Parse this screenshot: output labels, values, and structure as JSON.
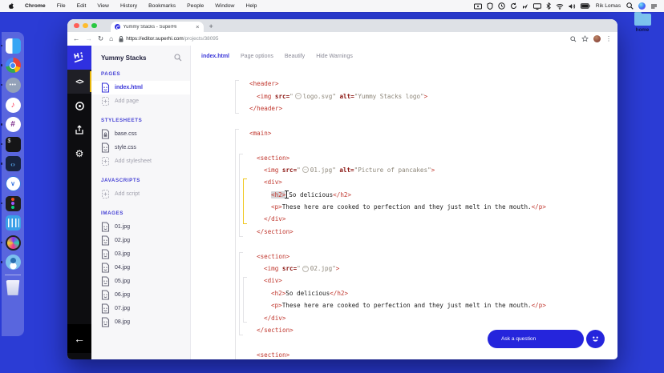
{
  "menu_bar": {
    "items": [
      "Chrome",
      "File",
      "Edit",
      "View",
      "History",
      "Bookmarks",
      "People",
      "Window",
      "Help"
    ],
    "status_icons": [
      "screen-mirror",
      "shield",
      "clock",
      "sync",
      "location",
      "display",
      "bluetooth",
      "wifi",
      "volume",
      "battery"
    ],
    "username": "Rik Lomas",
    "right_icons": [
      "spotlight",
      "siri",
      "notification-center"
    ]
  },
  "desktop": {
    "folder_label": "home"
  },
  "dock": {
    "apps": [
      {
        "name": "finder",
        "kind": "finder",
        "running": true,
        "glyph": ""
      },
      {
        "name": "chrome",
        "kind": "chrome",
        "running": true,
        "glyph": ""
      },
      {
        "name": "messages",
        "kind": "messages",
        "running": true,
        "glyph": "•••"
      },
      {
        "name": "music",
        "kind": "music",
        "running": false,
        "glyph": "♪"
      },
      {
        "name": "slack",
        "kind": "slack",
        "running": true,
        "glyph": "#"
      },
      {
        "name": "terminal",
        "kind": "terminal",
        "running": true,
        "glyph": "$"
      },
      {
        "name": "vscode",
        "kind": "vscode",
        "running": true,
        "glyph": "‹›"
      },
      {
        "name": "mail",
        "kind": "mail",
        "running": false,
        "glyph": "∨"
      },
      {
        "name": "figma",
        "kind": "figma",
        "running": true,
        "glyph": ""
      },
      {
        "name": "intercom",
        "kind": "intercom",
        "running": false,
        "glyph": ""
      },
      {
        "name": "screenflow",
        "kind": "screenflow",
        "running": true,
        "glyph": ""
      },
      {
        "name": "twitterrific",
        "kind": "twitterrific",
        "running": true,
        "glyph": ""
      }
    ],
    "trash": {
      "name": "trash",
      "kind": "trash"
    }
  },
  "browser": {
    "tab_title": "Yummy Stacks - SuperHi",
    "close_tab": "×",
    "new_tab": "+",
    "back": "←",
    "forward": "→",
    "reload": "↻",
    "home": "⌂",
    "url_domain": "https://editor.superhi.com",
    "url_path": "/projects/38095",
    "kebab": "⋮"
  },
  "editor": {
    "project_title": "Yummy Stacks",
    "rail": {
      "code_glyph": "<>",
      "gear_glyph": "⚙",
      "back_glyph": "←"
    },
    "panel_sections": [
      {
        "header": "PAGES",
        "items": [
          {
            "label": "index.html",
            "icon": "doc",
            "active": true
          }
        ],
        "add": "Add page"
      },
      {
        "header": "STYLESHEETS",
        "items": [
          {
            "label": "base.css",
            "icon": "doc-lock",
            "active": false
          },
          {
            "label": "style.css",
            "icon": "doc",
            "active": false
          }
        ],
        "add": "Add stylesheet"
      },
      {
        "header": "JAVASCRIPTS",
        "items": [],
        "add": "Add script"
      },
      {
        "header": "IMAGES",
        "items": [
          {
            "label": "01.jpg",
            "icon": "doc",
            "active": false
          },
          {
            "label": "02.jpg",
            "icon": "doc",
            "active": false
          },
          {
            "label": "03.jpg",
            "icon": "doc",
            "active": false
          },
          {
            "label": "04.jpg",
            "icon": "doc",
            "active": false
          },
          {
            "label": "05.jpg",
            "icon": "doc",
            "active": false
          },
          {
            "label": "06.jpg",
            "icon": "doc",
            "active": false
          },
          {
            "label": "07.jpg",
            "icon": "doc",
            "active": false
          },
          {
            "label": "08.jpg",
            "icon": "doc",
            "active": false
          }
        ],
        "add": null
      }
    ],
    "tabs": [
      {
        "label": "index.html",
        "active": true
      },
      {
        "label": "Page options",
        "active": false
      },
      {
        "label": "Beautify",
        "active": false
      },
      {
        "label": "Hide Warnings",
        "active": false
      }
    ],
    "code": {
      "lines": [
        {
          "i": 0,
          "seg": [
            [
              "tag",
              "<header>"
            ]
          ]
        },
        {
          "i": 1,
          "seg": [
            [
              "tag",
              "<img"
            ],
            [
              "plain",
              " "
            ],
            [
              "attr",
              "src="
            ],
            [
              "q",
              "\""
            ],
            [
              "chip",
              "logo.svg"
            ],
            [
              "q",
              "\""
            ],
            [
              "plain",
              " "
            ],
            [
              "attr",
              "alt="
            ],
            [
              "q",
              "\"Yummy Stacks logo\""
            ],
            [
              "tag",
              ">"
            ]
          ]
        },
        {
          "i": 0,
          "seg": [
            [
              "tag",
              "</header>"
            ]
          ]
        },
        null,
        {
          "i": 0,
          "seg": [
            [
              "tag",
              "<main>"
            ]
          ]
        },
        null,
        {
          "i": 1,
          "seg": [
            [
              "tag",
              "<section>"
            ]
          ]
        },
        {
          "i": 2,
          "seg": [
            [
              "tag",
              "<img"
            ],
            [
              "plain",
              " "
            ],
            [
              "attr",
              "src="
            ],
            [
              "q",
              "\""
            ],
            [
              "chip",
              "01.jpg"
            ],
            [
              "q",
              "\""
            ],
            [
              "plain",
              " "
            ],
            [
              "attr",
              "alt="
            ],
            [
              "q",
              "\"Picture of pancakes\""
            ],
            [
              "tag",
              ">"
            ]
          ]
        },
        {
          "i": 2,
          "seg": [
            [
              "tag",
              "<div>"
            ]
          ]
        },
        {
          "i": 3,
          "seg": [
            [
              "sel",
              "<h2>"
            ],
            [
              "cursor",
              ""
            ],
            [
              "txt",
              "So delicious"
            ],
            [
              "tag",
              "</h2>"
            ]
          ]
        },
        {
          "i": 3,
          "seg": [
            [
              "tag",
              "<p>"
            ],
            [
              "txt",
              "These here are cooked to perfection and they just melt in the mouth."
            ],
            [
              "tag",
              "</p>"
            ]
          ]
        },
        {
          "i": 2,
          "seg": [
            [
              "tag",
              "</div>"
            ]
          ]
        },
        {
          "i": 1,
          "seg": [
            [
              "tag",
              "</section>"
            ]
          ]
        },
        null,
        {
          "i": 1,
          "seg": [
            [
              "tag",
              "<section>"
            ]
          ]
        },
        {
          "i": 2,
          "seg": [
            [
              "tag",
              "<img"
            ],
            [
              "plain",
              " "
            ],
            [
              "attr",
              "src="
            ],
            [
              "q",
              "\""
            ],
            [
              "chip",
              "02.jpg"
            ],
            [
              "q",
              "\""
            ],
            [
              "tag",
              ">"
            ]
          ]
        },
        {
          "i": 2,
          "seg": [
            [
              "tag",
              "<div>"
            ]
          ]
        },
        {
          "i": 3,
          "seg": [
            [
              "tag",
              "<h2>"
            ],
            [
              "txt",
              "So delicious"
            ],
            [
              "tag",
              "</h2>"
            ]
          ]
        },
        {
          "i": 3,
          "seg": [
            [
              "tag",
              "<p>"
            ],
            [
              "txt",
              "These here are cooked to perfection and they just melt in the mouth."
            ],
            [
              "tag",
              "</p>"
            ]
          ]
        },
        {
          "i": 2,
          "seg": [
            [
              "tag",
              "</div>"
            ]
          ]
        },
        {
          "i": 1,
          "seg": [
            [
              "tag",
              "</section>"
            ]
          ]
        },
        null,
        {
          "i": 1,
          "seg": [
            [
              "tag",
              "<section>"
            ]
          ]
        }
      ],
      "guides": [
        {
          "from": 1,
          "to": 3,
          "x": 55,
          "color": "gray"
        },
        {
          "from": 5,
          "to": 23,
          "x": 55,
          "color": "gray"
        },
        {
          "from": 7,
          "to": 13,
          "x": 60,
          "color": "gray"
        },
        {
          "from": 9,
          "to": 12,
          "x": 65,
          "color": "yellow"
        },
        {
          "from": 15,
          "to": 21,
          "x": 60,
          "color": "gray"
        },
        {
          "from": 17,
          "to": 20,
          "x": 65,
          "color": "gray"
        }
      ]
    },
    "chat": {
      "ask_label": "Ask a question"
    }
  },
  "colors": {
    "desktop_blue": "#2b3cd5",
    "accent_indigo": "#3a36d8",
    "brand_blue": "#2f30e0",
    "pill_blue": "#2525dc",
    "active_bar_yellow": "#e7b60a",
    "tag_red": "#c0372e",
    "attr_maroon": "#8a1410",
    "value_gray": "#8d8679",
    "traffic_red": "#ff5f57",
    "traffic_yellow": "#febc2e",
    "traffic_green": "#28c840"
  }
}
